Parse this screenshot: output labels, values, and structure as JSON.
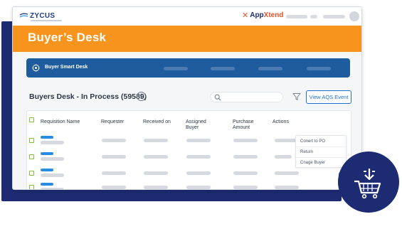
{
  "brand": {
    "logo": "ZYCUS",
    "partner_mark": "✕",
    "partner_part1": "App",
    "partner_part2": "Xtend"
  },
  "banner": {
    "title": "Buyer’s Desk"
  },
  "smartbar": {
    "label": "Buyer Smart Desk"
  },
  "page": {
    "title": "Buyers Desk - In Process (59589)"
  },
  "toolbar": {
    "search_placeholder": "",
    "view_button": "View AQS Event"
  },
  "table": {
    "headers": {
      "requisition": "Requisition Name",
      "requester": "Requester",
      "received": "Received on",
      "assigned_1": "Assigned",
      "assigned_2": "Buyer",
      "purchase_1": "Purchase",
      "purchase_2": "Amount",
      "actions": "Actions"
    },
    "menu": [
      "Conert to PO",
      "Return",
      "Cnage Buyer"
    ]
  },
  "colors": {
    "navy": "#1d2b72",
    "orange": "#f7941d",
    "smartbar": "#1e5c9e",
    "accent": "#1e6fd0",
    "checkbox": "#7fbf3a"
  },
  "icons": {
    "info": "info-icon",
    "search": "search-icon",
    "filter": "filter-icon",
    "cart": "cart-download-icon"
  }
}
